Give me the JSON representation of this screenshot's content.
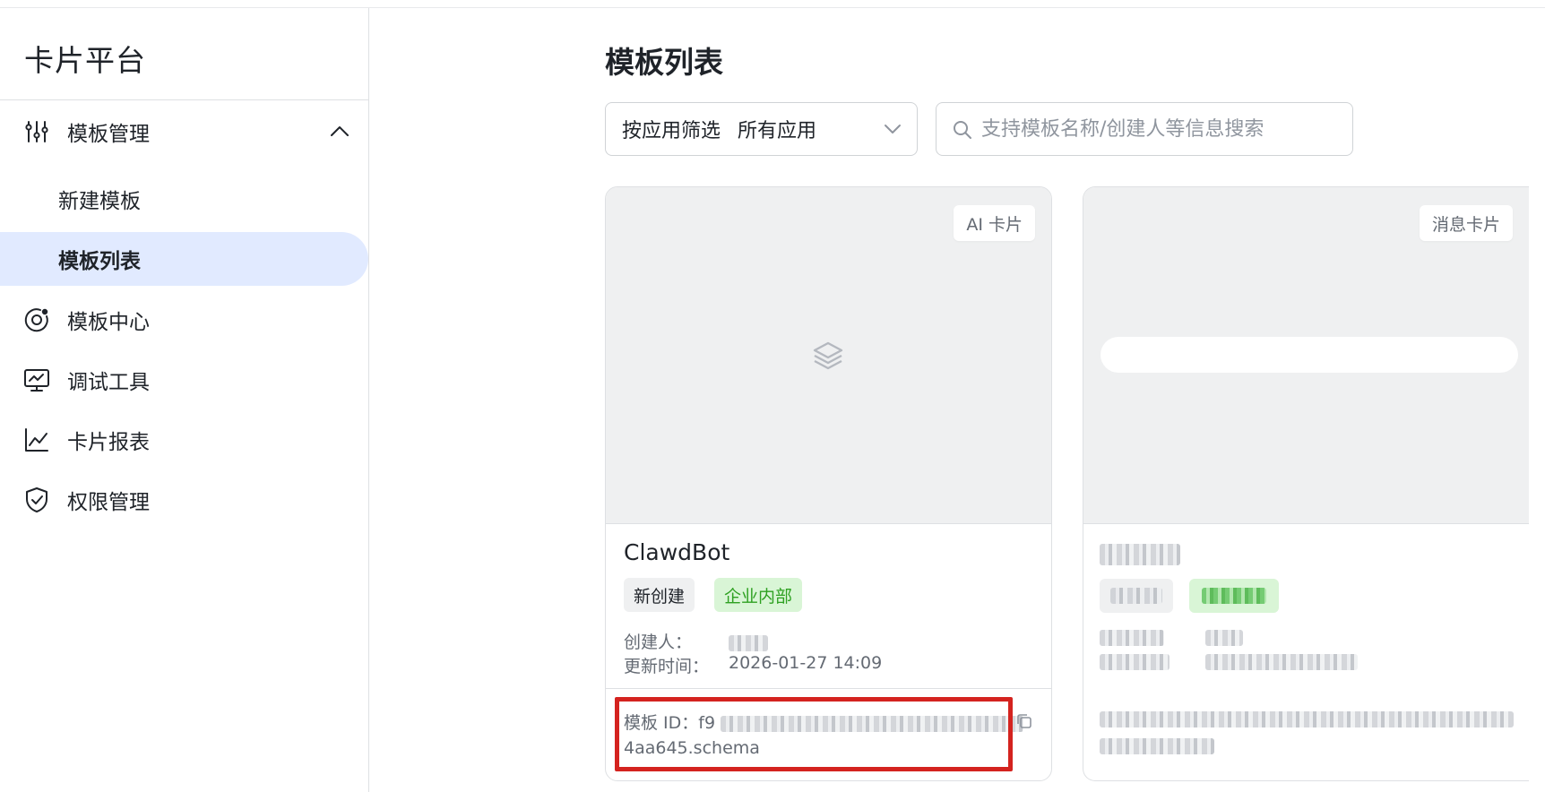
{
  "sidebar": {
    "brand": "卡片平台",
    "items": [
      {
        "label": "模板管理",
        "icon": "sliders-icon",
        "expanded": true
      },
      {
        "label": "新建模板"
      },
      {
        "label": "模板列表",
        "active": true
      },
      {
        "label": "模板中心",
        "icon": "template-center-icon"
      },
      {
        "label": "调试工具",
        "icon": "monitor-icon"
      },
      {
        "label": "卡片报表",
        "icon": "line-chart-icon"
      },
      {
        "label": "权限管理",
        "icon": "shield-icon"
      }
    ]
  },
  "main": {
    "title": "模板列表",
    "filter": {
      "label": "按应用筛选",
      "value": "所有应用"
    },
    "search": {
      "placeholder": "支持模板名称/创建人等信息搜索"
    },
    "cards": [
      {
        "type_badge": "AI 卡片",
        "name": "ClawdBot",
        "tags": [
          "新创建",
          "企业内部"
        ],
        "creator_label": "创建人：",
        "updated_label": "更新时间：",
        "updated_value": "2026-01-27 14:09",
        "id_label": "模板 ID：",
        "id_prefix": "f9",
        "id_suffix": "4aa645.schema"
      },
      {
        "type_badge": "消息卡片"
      }
    ]
  },
  "colors": {
    "accent_bg": "#e1eaff",
    "tag_green": "#2ea121",
    "tag_green_bg": "#d9f5d6",
    "highlight": "#d4231f"
  }
}
